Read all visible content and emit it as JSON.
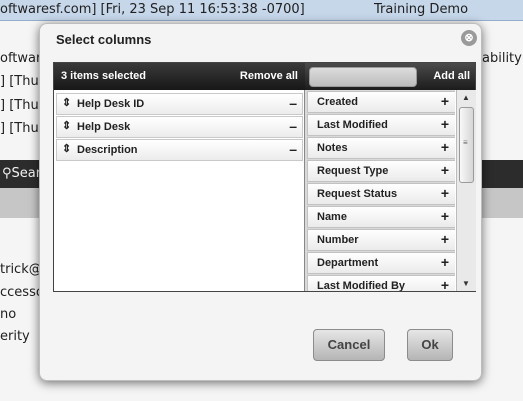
{
  "background": {
    "header_text": "oftwaresf.com] [Fri, 23 Sep 11 16:53:38 -0700]",
    "header_right": "Training Demo",
    "row2_left": "oftwaresf",
    "row2_right": "ability to",
    "row3": "] [Thu,",
    "row4": "] [Thu,",
    "row5": "] [Thu,",
    "search_text": "Search",
    "field1": "trick@",
    "field2": "ccessor",
    "field3": "no",
    "field4": "erity"
  },
  "dialog": {
    "title": "Select columns",
    "close_glyph": "⊗",
    "selected_count": "3 items selected",
    "remove_all": "Remove all",
    "add_all": "Add all",
    "search_placeholder": "",
    "selected_items": [
      {
        "label": "Help Desk ID"
      },
      {
        "label": "Help Desk"
      },
      {
        "label": "Description"
      }
    ],
    "available_items": [
      {
        "label": "Created"
      },
      {
        "label": "Last Modified"
      },
      {
        "label": "Notes"
      },
      {
        "label": "Request Type"
      },
      {
        "label": "Request Status"
      },
      {
        "label": "Name"
      },
      {
        "label": "Number"
      },
      {
        "label": "Department"
      },
      {
        "label": "Last Modified By"
      }
    ],
    "cancel_label": "Cancel",
    "ok_label": "Ok"
  },
  "icons": {
    "grip": "⇕",
    "minus": "–",
    "plus": "+",
    "scroll_up": "▲",
    "scroll_down": "▼",
    "scroll_grip": "≡"
  }
}
